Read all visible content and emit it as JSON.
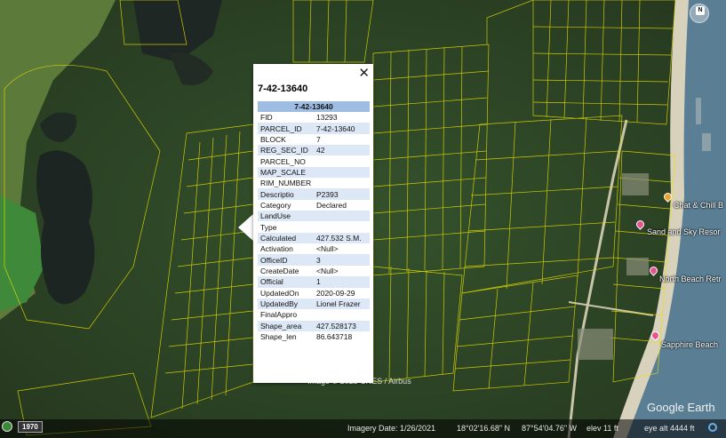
{
  "popup": {
    "title": "7-42-13640",
    "header": "7-42-13640",
    "close_glyph": "✕",
    "rows": [
      {
        "key": "FID",
        "value": "13293"
      },
      {
        "key": "PARCEL_ID",
        "value": "7-42-13640"
      },
      {
        "key": "BLOCK",
        "value": "7"
      },
      {
        "key": "REG_SEC_ID",
        "value": "42"
      },
      {
        "key": "PARCEL_NO",
        "value": ""
      },
      {
        "key": "MAP_SCALE",
        "value": ""
      },
      {
        "key": "RIM_NUMBER",
        "value": ""
      },
      {
        "key": "Descriptio",
        "value": "P2393"
      },
      {
        "key": "Category",
        "value": "Declared"
      },
      {
        "key": "LandUse",
        "value": ""
      },
      {
        "key": "Type",
        "value": ""
      },
      {
        "key": "Calculated",
        "value": "427.532 S.M."
      },
      {
        "key": "Activation",
        "value": "<Null>"
      },
      {
        "key": "OfficeID",
        "value": "3"
      },
      {
        "key": "CreateDate",
        "value": "<Null>"
      },
      {
        "key": "Official",
        "value": "1"
      },
      {
        "key": "UpdatedOn",
        "value": "2020-09-29"
      },
      {
        "key": "UpdatedBy",
        "value": "Lionel Frazer"
      },
      {
        "key": "FinalAppro",
        "value": ""
      },
      {
        "key": "Shape_area",
        "value": "427.528173"
      },
      {
        "key": "Shape_len",
        "value": "86.643718"
      }
    ]
  },
  "places": {
    "chat_chill": "Chat & Chill B",
    "sand_sky": "Sand and Sky Resor",
    "north_beach": "North Beach Retr",
    "sapphire": "Sapphire Beach"
  },
  "compass": {
    "label": "N"
  },
  "map_overlay": {
    "copyright": "Image © 2023 CNES / Airbus",
    "logo": "Google Earth"
  },
  "statusbar": {
    "year": "1970",
    "imagery_date": "Imagery Date: 1/26/2021",
    "lat": "18°02'16.68\" N",
    "lon": "87°54'04.76\" W",
    "elev": "elev    11 ft",
    "eye_alt": "eye alt   4444 ft"
  },
  "colors": {
    "parcel_lines": "#e8e000",
    "popup_header": "#9fbde3",
    "popup_alt_row": "#dde8f6",
    "pin": "#e8538f",
    "pin_food": "#f0a030"
  }
}
